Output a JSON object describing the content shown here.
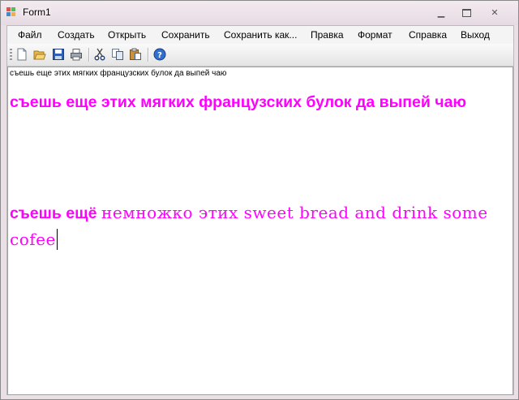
{
  "window": {
    "title": "Form1"
  },
  "menu": [
    "Файл",
    "Создать",
    "Открыть",
    "Сохранить",
    "Сохранить как...",
    "Правка",
    "Формат",
    "Справка",
    "Выход"
  ],
  "toolbar": {
    "icons": [
      "new-file-icon",
      "open-folder-icon",
      "save-icon",
      "print-icon",
      "cut-icon",
      "copy-icon",
      "paste-icon",
      "help-icon"
    ]
  },
  "editor": {
    "line1": "съешь еще этих мягких французских булок да выпей чаю",
    "line2": "съешь еще этих мягких французских булок да выпей чаю",
    "line3_bold": "съешь ещё",
    "line3_fancy": "немножко этих sweet bread and drink some cofee",
    "text_color": "#ff00ff"
  }
}
